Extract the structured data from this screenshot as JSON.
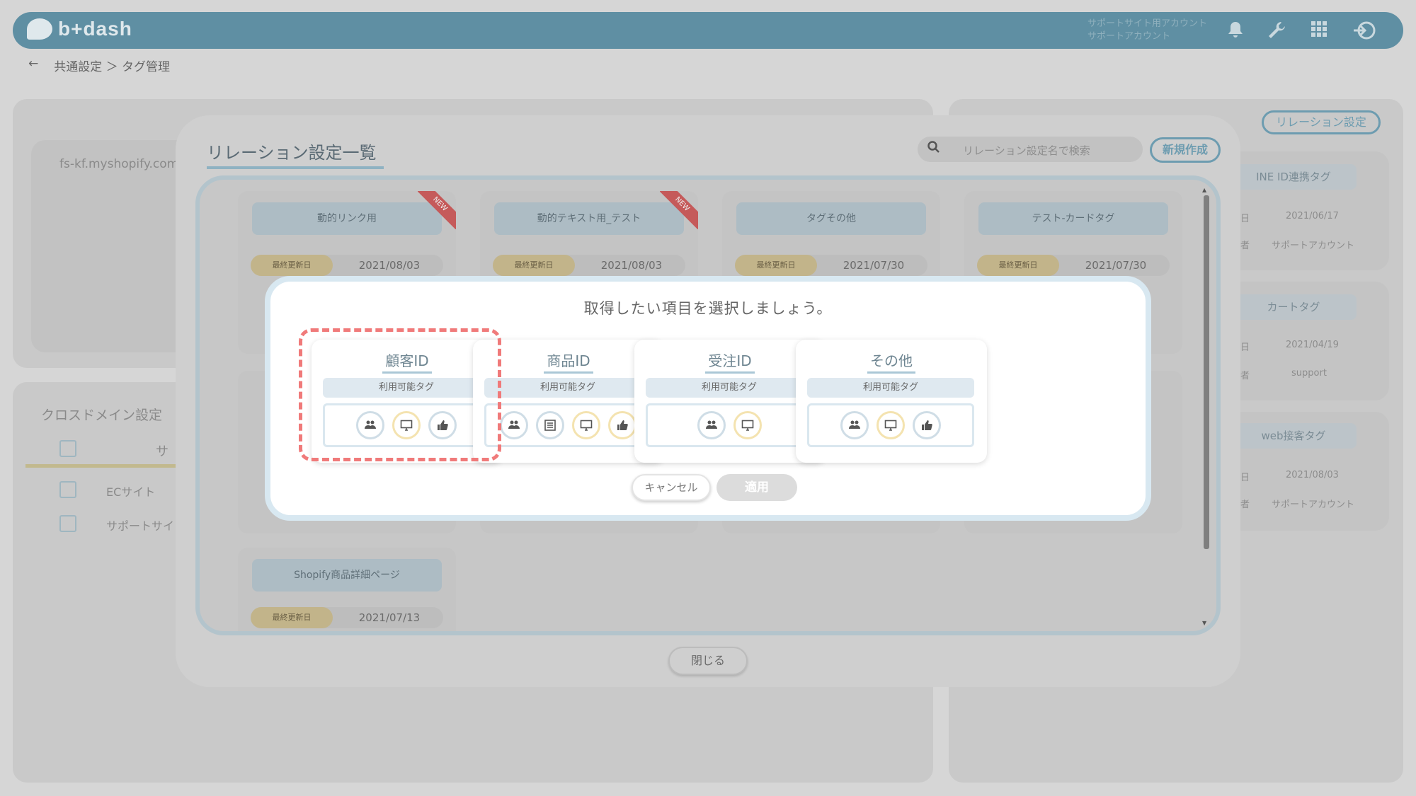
{
  "header": {
    "brand": "b+dash",
    "account_line1": "サポートサイト用アカウント",
    "account_line2": "サポートアカウント"
  },
  "breadcrumb": {
    "back": "←",
    "path": "共通設定 ＞ タグ管理"
  },
  "background": {
    "site_url": "fs-kf.myshopify.com",
    "cross_domain_title": "クロスドメイン設定",
    "col_header": "サ",
    "rows": [
      "ECサイト",
      "サポートサイ"
    ],
    "relation_setting_btn": "リレーション設定",
    "right_tags": [
      {
        "title": "INE ID連携タグ",
        "date": "2021/06/17",
        "owner": "サポートアカウント",
        "d_lbl": "日",
        "o_lbl": "者"
      },
      {
        "title": "カートタグ",
        "date": "2021/04/19",
        "owner": "support",
        "d_lbl": "日",
        "o_lbl": "者"
      },
      {
        "title": "web接客タグ",
        "date": "2021/08/03",
        "owner": "サポートアカウント",
        "d_lbl": "日",
        "o_lbl": "者"
      }
    ]
  },
  "outer_modal": {
    "title": "リレーション設定一覧",
    "search_placeholder": "リレーション設定名で検索",
    "new_button": "新規作成",
    "close_button": "閉じる",
    "date_label": "最終更新日",
    "new_badge": "NEW",
    "cards": [
      {
        "title": "動的リンク用",
        "date": "2021/08/03"
      },
      {
        "title": "動的テキスト用_テスト",
        "date": "2021/08/03"
      },
      {
        "title": "タグその他",
        "date": "2021/07/30"
      },
      {
        "title": "テスト-カードタグ",
        "date": "2021/07/30"
      },
      {
        "title": "Shopify商品詳細ページ",
        "date": "2021/07/13"
      }
    ]
  },
  "dialog": {
    "title": "取得したい項目を選択しましょう。",
    "tag_bar_label": "利用可能タグ",
    "options": [
      {
        "title": "顧客ID",
        "selected": true
      },
      {
        "title": "商品ID",
        "selected": false
      },
      {
        "title": "受注ID",
        "selected": false
      },
      {
        "title": "その他",
        "selected": false
      }
    ],
    "cancel": "キャンセル",
    "apply": "適用"
  },
  "colors": {
    "header": "#5f8fa3",
    "accent": "#6d9cb0",
    "selected_border": "#f07a7a",
    "icon_border_blue": "#cfdde6",
    "icon_border_yellow": "#f4e3b0"
  },
  "icons": [
    "bell-icon",
    "wrench-icon",
    "grid-icon",
    "logout-icon",
    "search-icon",
    "users-icon",
    "list-icon",
    "monitor-icon",
    "thumbs-up-icon"
  ]
}
